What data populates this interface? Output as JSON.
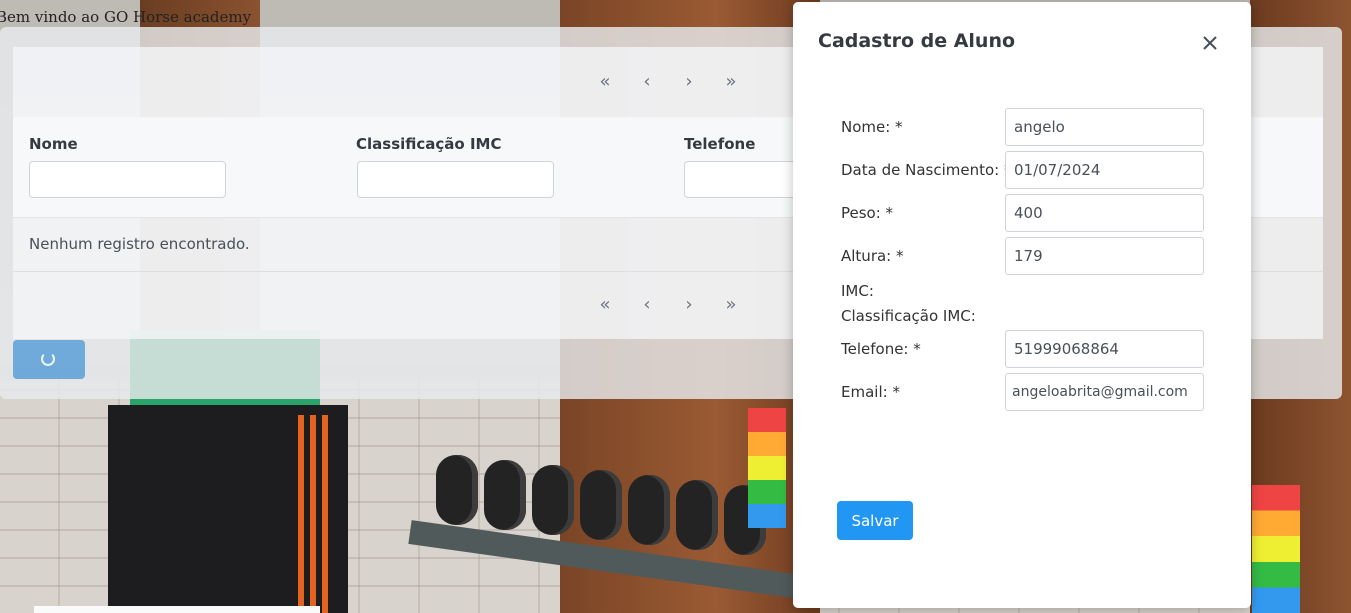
{
  "header": {
    "welcome": "Bem vindo ao GO Horse academy"
  },
  "table": {
    "paginator": {
      "first": "«",
      "prev": "‹",
      "next": "›",
      "last": "»"
    },
    "columns": [
      {
        "label": "Nome"
      },
      {
        "label": "Classificação IMC"
      },
      {
        "label": "Telefone"
      }
    ],
    "empty_message": "Nenhum registro encontrado."
  },
  "modal": {
    "title": "Cadastro de Aluno",
    "close_icon": "close-icon",
    "fields": {
      "nome": {
        "label": "Nome:  *",
        "value": "angelo"
      },
      "nascimento": {
        "label": "Data de Nascimento:  *",
        "value": "01/07/2024"
      },
      "peso": {
        "label": "Peso:  *",
        "value": "400"
      },
      "altura": {
        "label": "Altura:  *",
        "value": "179"
      },
      "imc": {
        "label": "IMC:"
      },
      "classificacao": {
        "label": "Classificação IMC:"
      },
      "telefone": {
        "label": "Telefone:  *",
        "value": "51999068864"
      },
      "email": {
        "label": "Email:  *",
        "value": "angeloabrita@gmail.com"
      }
    },
    "save_label": "Salvar"
  },
  "colors": {
    "primary": "#2196f3",
    "overlay": "#e8eaed"
  }
}
